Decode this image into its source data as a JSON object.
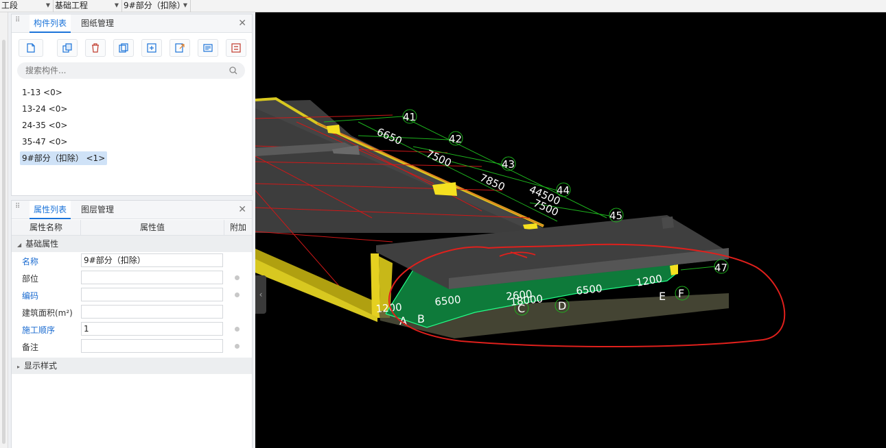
{
  "topbar": {
    "combo1": "工段",
    "combo2": "基础工程",
    "combo3": "9#部分（扣除）"
  },
  "component_panel": {
    "tab_active": "构件列表",
    "tab_other": "图纸管理",
    "search_placeholder": "搜索构件...",
    "items": [
      {
        "label": "1-13 <0>"
      },
      {
        "label": "13-24 <0>"
      },
      {
        "label": "24-35 <0>"
      },
      {
        "label": "35-47 <0>"
      },
      {
        "label": "9#部分（扣除） <1>",
        "selected": true
      }
    ],
    "toolbar_icons": [
      "new-icon",
      "copy-icon",
      "delete-icon",
      "duplicate-icon",
      "copy-floor-icon",
      "export-icon",
      "properties-icon",
      "settings-icon"
    ]
  },
  "property_panel": {
    "tab_active": "属性列表",
    "tab_other": "图层管理",
    "col_name": "属性名称",
    "col_value": "属性值",
    "col_extra": "附加",
    "group_basic": "基础属性",
    "group_display": "显示样式",
    "rows": [
      {
        "name": "名称",
        "value": "9#部分（扣除）",
        "blue": true,
        "dot": false
      },
      {
        "name": "部位",
        "value": "",
        "blue": false,
        "dot": true
      },
      {
        "name": "编码",
        "value": "",
        "blue": true,
        "dot": true
      },
      {
        "name": "建筑面积(m²)",
        "value": "",
        "blue": false,
        "dot": false
      },
      {
        "name": "施工顺序",
        "value": "1",
        "blue": true,
        "dot": true
      },
      {
        "name": "备注",
        "value": "",
        "blue": false,
        "dot": true
      }
    ]
  },
  "viewport": {
    "axis_labels": [
      "41",
      "42",
      "43",
      "44",
      "45",
      "47"
    ],
    "dimension_labels": [
      "6650",
      "7500",
      "7850",
      "44500",
      "7500"
    ],
    "region_labels": [
      "A",
      "B",
      "C",
      "D",
      "E",
      "F"
    ],
    "region_dims": [
      "1200",
      "6500",
      "2600",
      "18000",
      "6500",
      "1200"
    ]
  },
  "colors": {
    "accent_blue": "#1a73d9",
    "slab_gray": "#3d3d3d",
    "highlight_green": "#0e7a3a",
    "axis_green": "#1db31d",
    "annotation_red": "#e0201c",
    "edge_yellow": "#f0e020"
  }
}
